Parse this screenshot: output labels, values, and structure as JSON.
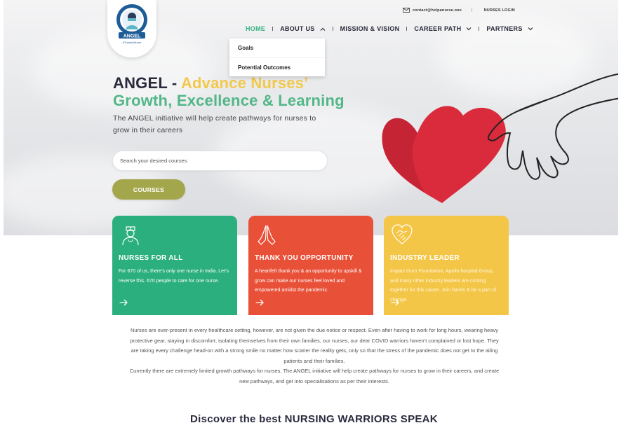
{
  "header": {
    "contact_email": "contact@helpanurse.one",
    "separator": "|",
    "login_label": "NURSES LOGIN",
    "logo_text": "ANGEL",
    "logo_tag": "#ThankANurse"
  },
  "nav": {
    "items": [
      {
        "label": "HOME"
      },
      {
        "label": "ABOUT US"
      },
      {
        "label": "MISSION & VISION"
      },
      {
        "label": "CAREER PATH"
      },
      {
        "label": "PARTNERS"
      }
    ],
    "dropdown": [
      "Goals",
      "Potential Outcomes"
    ]
  },
  "hero": {
    "title_part1": "ANGEL - ",
    "title_part2": "Advance Nurses’",
    "title_line2": "Growth, Excellence & Learning",
    "subtitle": "The ANGEL initiative will help create pathways for nurses to grow in their careers",
    "search_placeholder": "Search your desired courses",
    "courses_button": "COURSES"
  },
  "cards": [
    {
      "title": "NURSES FOR ALL",
      "text": "For 670 of us, there’s only one nurse in India. Let’s reverse this. 670 people to care for one nurse.",
      "color": "#2baf7f"
    },
    {
      "title": "THANK YOU OPPORTUNITY",
      "text": "A heartfelt thank you & an opportunity to upskill & grow can make our nurses feel loved and empowered amidst the pandemic.",
      "color": "#e95038"
    },
    {
      "title": "INDUSTRY LEADER",
      "text": "Impact Guru Foundation, Apollo hospital Group, and many other industry leaders are coming together for this cause. Join hands & be a part of change.",
      "color": "#f4c647"
    }
  ],
  "intro": {
    "paragraph1": "Nurses are ever-present in every healthcare setting, however, are not given the due notice or respect. Even after having to work for long hours, wearing heavy protective gear, staying in discomfort, isolating themselves from their own families, our nurses, our dear COVID warriors haven’t complained or lost hope. They are taking every challenge head-on with a strong smile no matter how scarier the reality gets, only so that the stress of the pandemic does not get to the ailing patients and their families.",
    "paragraph2": "Currently there are extremely limited growth pathways for nurses. The ANGEL initiative will help create pathways for nurses to grow in their careers, and create new pathways, and get into specialisations as per their interests."
  },
  "section_title": "Discover the best NURSING WARRIORS SPEAK"
}
